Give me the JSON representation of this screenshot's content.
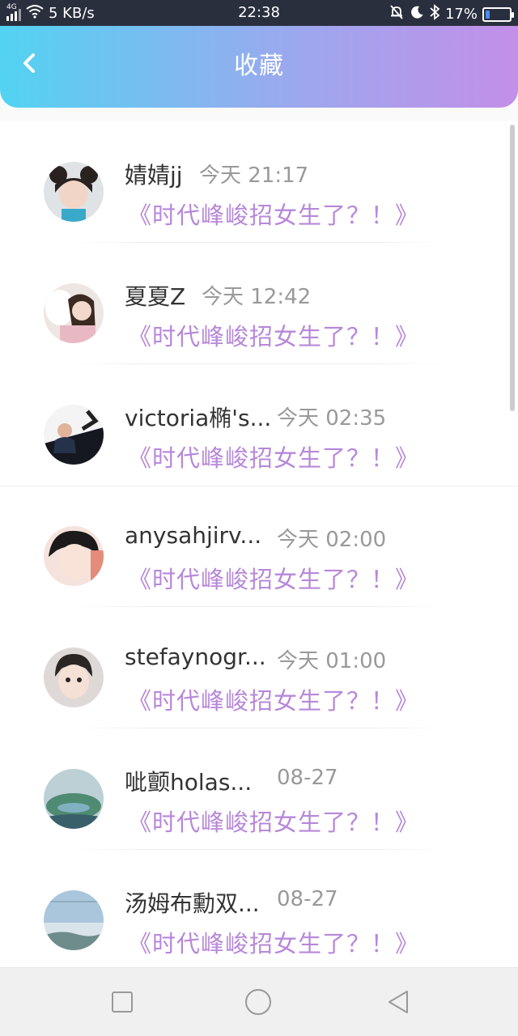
{
  "status_bar": {
    "network_type": "4G",
    "speed": "5 KB/s",
    "time": "22:38",
    "battery": "17%",
    "battery_level": 0.17,
    "icons": [
      "signal-icon",
      "wifi-icon",
      "mute-icon",
      "moon-icon",
      "bluetooth-icon",
      "battery-icon"
    ]
  },
  "header": {
    "title": "收藏",
    "back_icon": "back-chevron-icon"
  },
  "colors": {
    "header_gradient_start": "#52d3f1",
    "header_gradient_end": "#c38fe8",
    "link": "#b788da",
    "name": "#333333",
    "time": "#999999"
  },
  "favorites": [
    {
      "name": "婧婧jj",
      "time": "今天 21:17",
      "title": "《时代峰峻招女生了？！》"
    },
    {
      "name": "夏夏Z",
      "time": "今天 12:42",
      "title": "《时代峰峻招女生了？！》"
    },
    {
      "name": "victoria椭's...",
      "time": "今天 02:35",
      "title": "《时代峰峻招女生了？！》"
    },
    {
      "name": "anysahjirv...",
      "time": "今天 02:00",
      "title": "《时代峰峻招女生了？！》"
    },
    {
      "name": "stefaynogr...",
      "time": "今天 01:00",
      "title": "《时代峰峻招女生了？！》"
    },
    {
      "name": "呲颤holas...",
      "time": "08-27",
      "title": "《时代峰峻招女生了？！》"
    },
    {
      "name": "汤姆布勳双...",
      "time": "08-27",
      "title": "《时代峰峻招女生了？！》"
    }
  ],
  "nav_bar": {
    "icons": [
      "recent-apps-icon",
      "home-icon",
      "back-icon"
    ]
  }
}
